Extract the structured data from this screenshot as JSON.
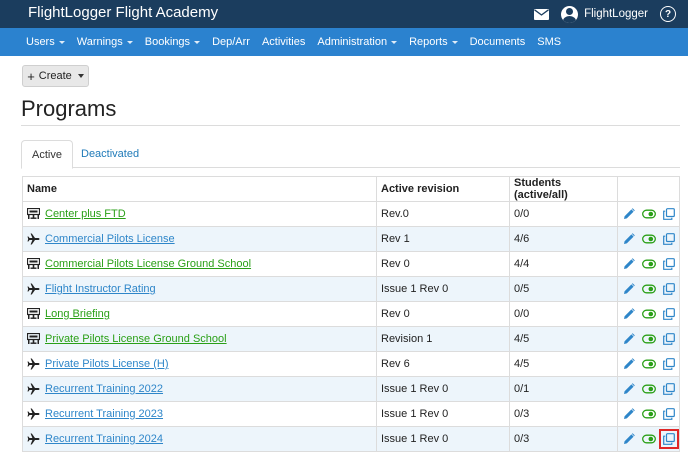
{
  "app": {
    "title": "FlightLogger Flight Academy",
    "user_name": "FlightLogger",
    "help_glyph": "?"
  },
  "nav": {
    "items": [
      {
        "label": "Users",
        "dropdown": true
      },
      {
        "label": "Warnings",
        "dropdown": true
      },
      {
        "label": "Bookings",
        "dropdown": true
      },
      {
        "label": "Dep/Arr",
        "dropdown": false
      },
      {
        "label": "Activities",
        "dropdown": false
      },
      {
        "label": "Administration",
        "dropdown": true
      },
      {
        "label": "Reports",
        "dropdown": true
      },
      {
        "label": "Documents",
        "dropdown": false
      },
      {
        "label": "SMS",
        "dropdown": false
      }
    ]
  },
  "toolbar": {
    "create_label": "Create",
    "plus_glyph": "+"
  },
  "page": {
    "title": "Programs"
  },
  "tabs": {
    "active": "Active",
    "deactivated": "Deactivated"
  },
  "table": {
    "headers": {
      "name": "Name",
      "revision": "Active revision",
      "students": "Students (active/all)"
    },
    "rows": [
      {
        "type": "simulator-icon",
        "name": "Center plus FTD",
        "link_color": "green",
        "revision": "Rev.0",
        "students": "0/0"
      },
      {
        "type": "airplane-icon",
        "name": "Commercial Pilots License",
        "link_color": "blue",
        "revision": "Rev 1",
        "students": "4/6"
      },
      {
        "type": "simulator-icon",
        "name": "Commercial Pilots License Ground School",
        "link_color": "green",
        "revision": "Rev 0",
        "students": "4/4"
      },
      {
        "type": "airplane-icon",
        "name": "Flight Instructor Rating",
        "link_color": "blue",
        "revision": "Issue 1 Rev 0",
        "students": "0/5"
      },
      {
        "type": "simulator-icon",
        "name": "Long Briefing",
        "link_color": "green",
        "revision": "Rev 0",
        "students": "0/0"
      },
      {
        "type": "simulator-icon",
        "name": "Private Pilots License Ground School",
        "link_color": "green",
        "revision": "Revision 1",
        "students": "4/5"
      },
      {
        "type": "airplane-icon",
        "name": "Private Pilots License (H)",
        "link_color": "blue",
        "revision": "Rev 6",
        "students": "4/5"
      },
      {
        "type": "airplane-icon",
        "name": "Recurrent Training 2022",
        "link_color": "blue",
        "revision": "Issue 1 Rev 0",
        "students": "0/1"
      },
      {
        "type": "airplane-icon",
        "name": "Recurrent Training 2023",
        "link_color": "blue",
        "revision": "Issue 1 Rev 0",
        "students": "0/3"
      },
      {
        "type": "airplane-icon",
        "name": "Recurrent Training 2024",
        "link_color": "blue",
        "revision": "Issue 1 Rev 0",
        "students": "0/3"
      }
    ],
    "action_icons": [
      "pencil-icon",
      "eye-toggle-icon",
      "copy-icon"
    ]
  },
  "colors": {
    "topbar": "#1b3d5e",
    "navbar": "#2b82cf",
    "link_blue": "#2e86c9",
    "link_green": "#2aa017",
    "highlight": "#e02727"
  }
}
